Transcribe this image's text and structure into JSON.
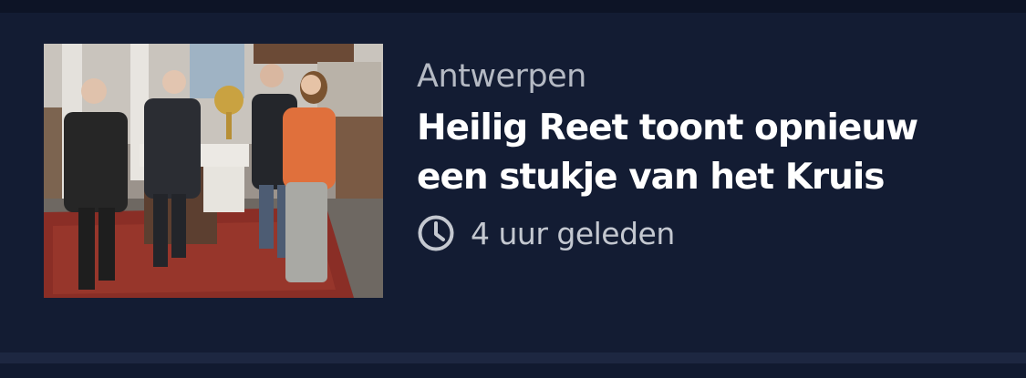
{
  "article": {
    "category": "Antwerpen",
    "headline_line1": "Heilig Reet toont opnieuw",
    "headline_line2": "een stukje van het Kruis",
    "time_icon": "clock-icon",
    "published": "4 uur geleden"
  },
  "colors": {
    "background": "#111a30",
    "card": "#131c33",
    "headline": "#ffffff",
    "category": "#b5bac4",
    "meta": "#c4c8d0"
  }
}
